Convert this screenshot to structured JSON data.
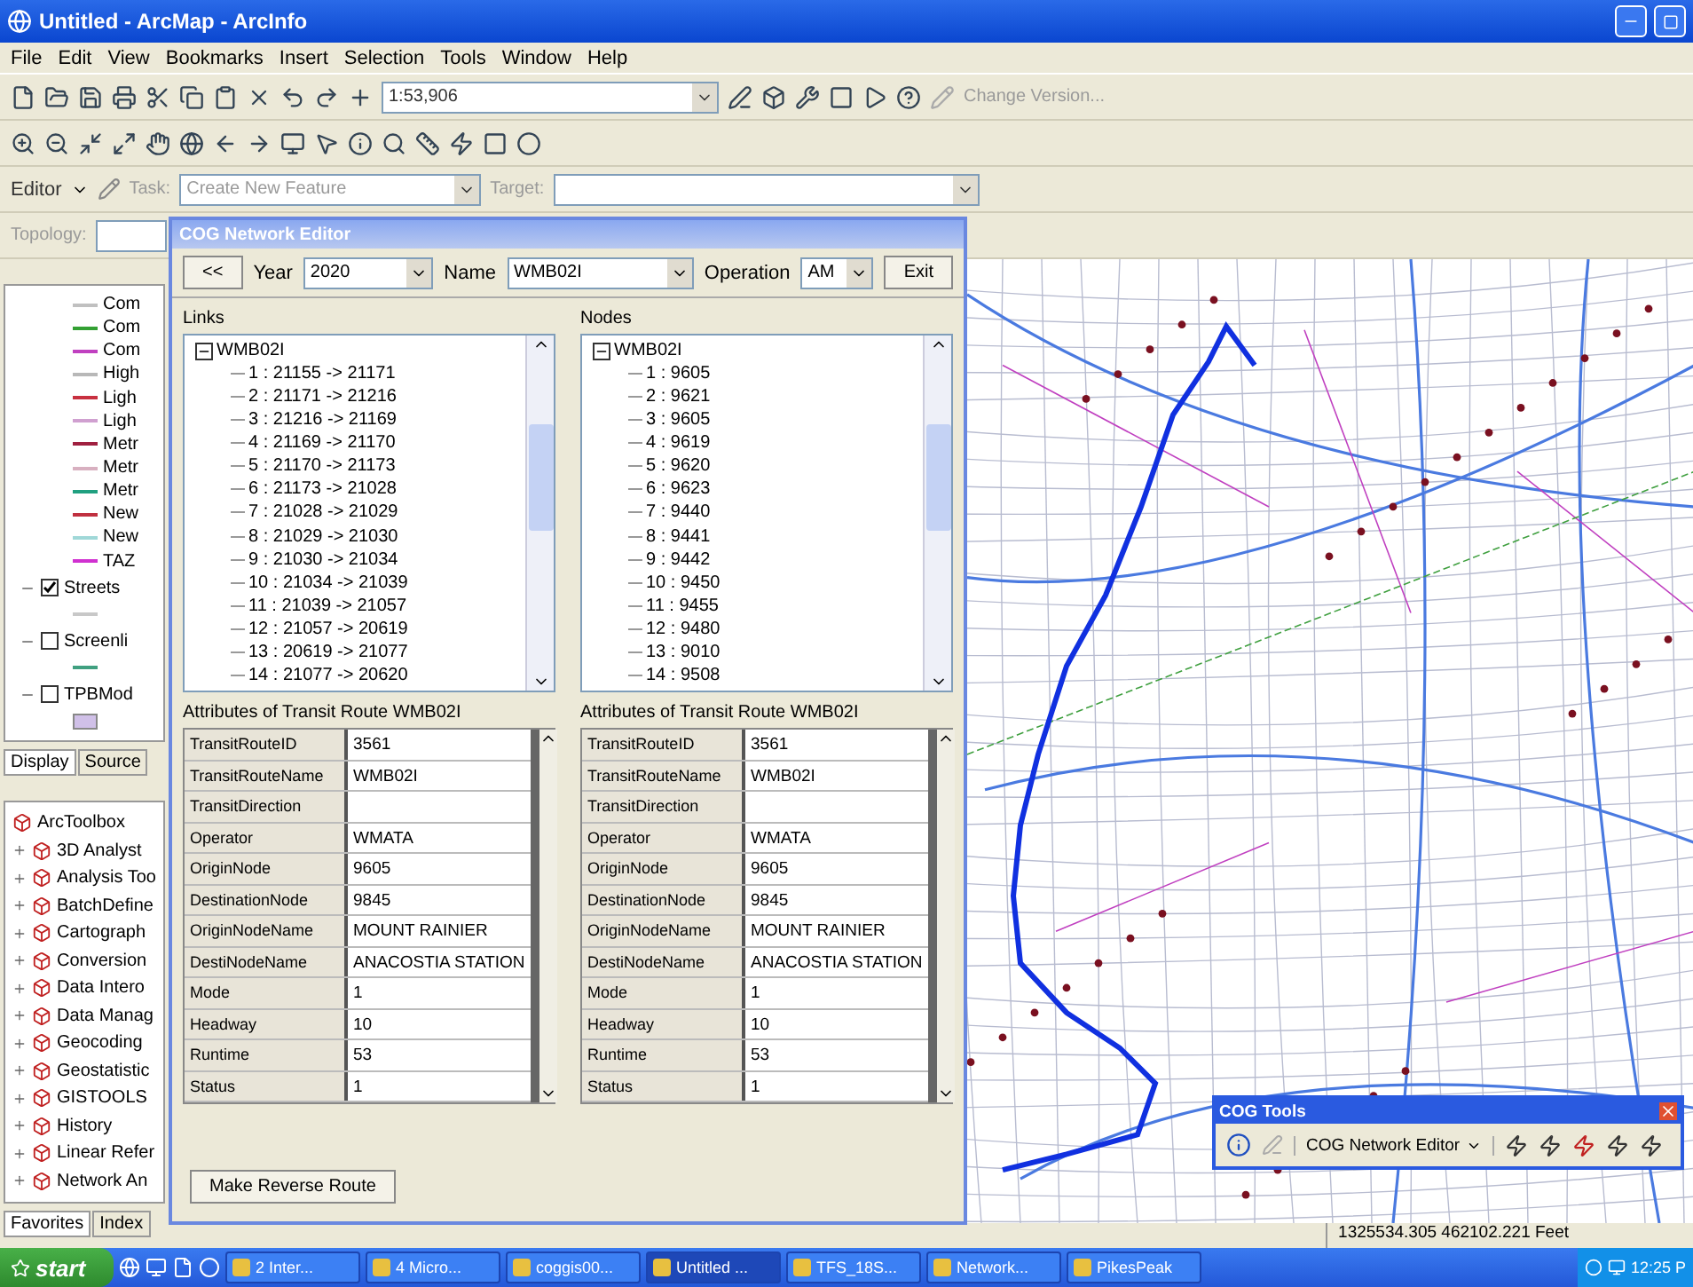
{
  "window": {
    "title": "Untitled - ArcMap - ArcInfo"
  },
  "menu": [
    "File",
    "Edit",
    "View",
    "Bookmarks",
    "Insert",
    "Selection",
    "Tools",
    "Window",
    "Help"
  ],
  "toolbar": {
    "scale": "1:53,906",
    "change_version": "Change Version..."
  },
  "editor_toolbar": {
    "editor": "Editor",
    "task_label": "Task:",
    "task": "Create New Feature",
    "target_label": "Target:"
  },
  "topology_toolbar": {
    "label": "Topology:"
  },
  "toc": {
    "legend": [
      {
        "label": "Com",
        "color": "#c0c0c0"
      },
      {
        "label": "Com",
        "color": "#33a033"
      },
      {
        "label": "Com",
        "color": "#c040c0"
      },
      {
        "label": "High",
        "color": "#b8b8b8"
      },
      {
        "label": "Ligh",
        "color": "#c83040"
      },
      {
        "label": "Ligh",
        "color": "#d0a0d0"
      },
      {
        "label": "Metr",
        "color": "#a02040"
      },
      {
        "label": "Metr",
        "color": "#d8b0c0"
      },
      {
        "label": "Metr",
        "color": "#20a080"
      },
      {
        "label": "New",
        "color": "#c03040"
      },
      {
        "label": "New",
        "color": "#a0d8d8"
      },
      {
        "label": "TAZ",
        "color": "#d030d0"
      }
    ],
    "layers": [
      {
        "label": "Streets",
        "checked": true,
        "kind": "line",
        "color": "#c8c8c8"
      },
      {
        "label": "Screenli",
        "checked": false,
        "kind": "line",
        "color": "#40a080"
      },
      {
        "label": "TPBMod",
        "checked": false,
        "kind": "fill",
        "color": "#d0c0e8"
      }
    ],
    "tabs": [
      {
        "label": "Display",
        "selected": true
      },
      {
        "label": "Source",
        "selected": false
      }
    ]
  },
  "toolbox": {
    "title": "ArcToolbox",
    "items": [
      "3D Analyst",
      "Analysis Too",
      "BatchDefine",
      "Cartograph",
      "Conversion",
      "Data Intero",
      "Data Manag",
      "Geocoding",
      "Geostatistic",
      "GISTOOLS",
      "History",
      "Linear Refer",
      "Network An"
    ],
    "tabs": [
      {
        "label": "Favorites",
        "selected": true
      },
      {
        "label": "Index",
        "selected": false
      }
    ]
  },
  "dialog": {
    "title": "COG Network Editor",
    "back": "<<",
    "year_label": "Year",
    "year": "2020",
    "name_label": "Name",
    "name": "WMB02I",
    "operation_label": "Operation",
    "operation": "AM",
    "exit": "Exit",
    "links": {
      "label": "Links",
      "tree": [
        {
          "label": "WMB02I",
          "expanded": true,
          "children": [
            {
              "label": "1 : 21155 -> 21171"
            },
            {
              "label": "2 : 21171 -> 21216"
            },
            {
              "label": "3 : 21216 -> 21169"
            },
            {
              "label": "4 : 21169 -> 21170"
            },
            {
              "label": "5 : 21170 -> 21173"
            },
            {
              "label": "6 : 21173 -> 21028"
            },
            {
              "label": "7 : 21028 -> 21029"
            },
            {
              "label": "8 : 21029 -> 21030"
            },
            {
              "label": "9 : 21030 -> 21034"
            },
            {
              "label": "10 : 21034 -> 21039"
            },
            {
              "label": "11 : 21039 -> 21057"
            },
            {
              "label": "12 : 21057 -> 20619"
            },
            {
              "label": "13 : 20619 -> 21077"
            },
            {
              "label": "14 : 21077 -> 20620"
            }
          ]
        }
      ]
    },
    "nodes": {
      "label": "Nodes",
      "tree": [
        {
          "label": "WMB02I",
          "expanded": true,
          "children": [
            {
              "label": "1 : 9605"
            },
            {
              "label": "2 : 9621"
            },
            {
              "label": "3 : 9605"
            },
            {
              "label": "4 : 9619"
            },
            {
              "label": "5 : 9620"
            },
            {
              "label": "6 : 9623"
            },
            {
              "label": "7 : 9440"
            },
            {
              "label": "8 : 9441"
            },
            {
              "label": "9 : 9442"
            },
            {
              "label": "10 : 9450"
            },
            {
              "label": "11 : 9455"
            },
            {
              "label": "12 : 9480"
            },
            {
              "label": "13 : 9010"
            },
            {
              "label": "14 : 9508"
            }
          ]
        }
      ]
    },
    "attributes": [
      {
        "label": "Attributes of Transit Route WMB02I",
        "rows": [
          {
            "field": "TransitRouteID",
            "value": "3561"
          },
          {
            "field": "TransitRouteName",
            "value": "WMB02I"
          },
          {
            "field": "TransitDirection",
            "value": ""
          },
          {
            "field": "Operator",
            "value": "WMATA"
          },
          {
            "field": "OriginNode",
            "value": "9605"
          },
          {
            "field": "DestinationNode",
            "value": "9845"
          },
          {
            "field": "OriginNodeName",
            "value": "MOUNT RAINIER"
          },
          {
            "field": "DestiNodeName",
            "value": "ANACOSTIA STATION"
          },
          {
            "field": "Mode",
            "value": "1"
          },
          {
            "field": "Headway",
            "value": "10"
          },
          {
            "field": "Runtime",
            "value": "53"
          },
          {
            "field": "Status",
            "value": "1"
          }
        ]
      },
      {
        "label": "Attributes of Transit Route WMB02I",
        "rows": [
          {
            "field": "TransitRouteID",
            "value": "3561"
          },
          {
            "field": "TransitRouteName",
            "value": "WMB02I"
          },
          {
            "field": "TransitDirection",
            "value": ""
          },
          {
            "field": "Operator",
            "value": "WMATA"
          },
          {
            "field": "OriginNode",
            "value": "9605"
          },
          {
            "field": "DestinationNode",
            "value": "9845"
          },
          {
            "field": "OriginNodeName",
            "value": "MOUNT RAINIER"
          },
          {
            "field": "DestiNodeName",
            "value": "ANACOSTIA STATION"
          },
          {
            "field": "Mode",
            "value": "1"
          },
          {
            "field": "Headway",
            "value": "10"
          },
          {
            "field": "Runtime",
            "value": "53"
          },
          {
            "field": "Status",
            "value": "1"
          }
        ]
      }
    ],
    "reverse_button": "Make Reverse Route"
  },
  "cog_tools": {
    "title": "COG Tools",
    "dropdown": "COG Network Editor"
  },
  "status_bar": {
    "coordinates": "1325534.305  462102.221 Feet"
  },
  "taskbar": {
    "start": "start",
    "tasks": [
      {
        "label": "2 Inter...",
        "selected": false
      },
      {
        "label": "4 Micro...",
        "selected": false
      },
      {
        "label": "coggis00...",
        "selected": false
      },
      {
        "label": "Untitled ...",
        "selected": true
      },
      {
        "label": "TFS_18S...",
        "selected": false
      },
      {
        "label": "Network...",
        "selected": false
      },
      {
        "label": "PikesPeak",
        "selected": false
      }
    ],
    "clock": "12:25 P"
  }
}
